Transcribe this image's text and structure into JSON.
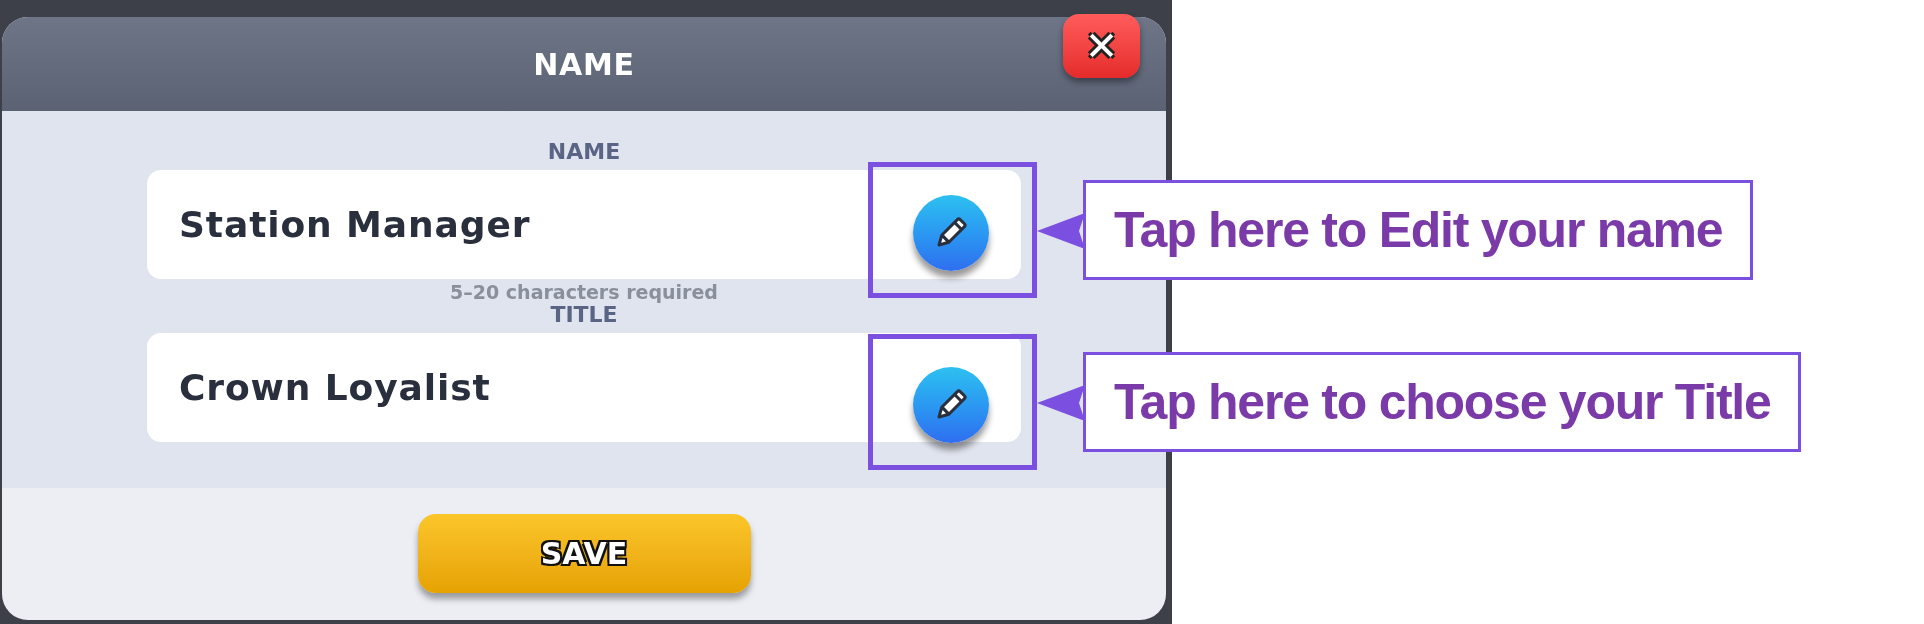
{
  "dialog": {
    "title": "NAME",
    "close_icon": "✕"
  },
  "fields": [
    {
      "label": "NAME",
      "value": "Station Manager",
      "hint": "5–20 characters required",
      "callout": "Tap here to Edit your name"
    },
    {
      "label": "TITLE",
      "value": "Crown Loyalist",
      "callout": "Tap here to choose your Title"
    }
  ],
  "save_button": "SAVE"
}
